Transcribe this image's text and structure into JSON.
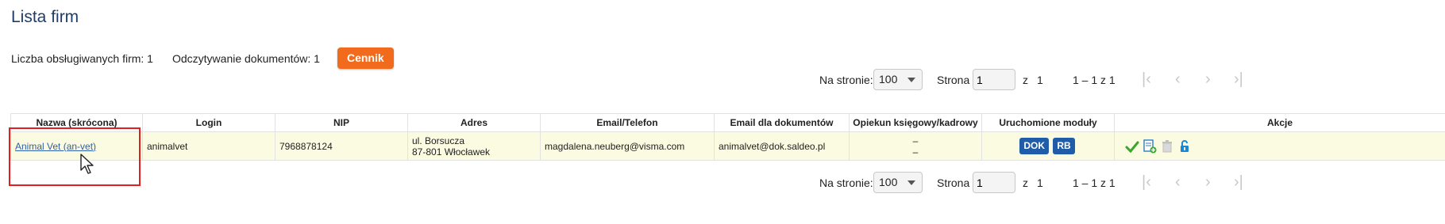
{
  "page": {
    "title": "Lista firm"
  },
  "info": {
    "firms_count": "Liczba obsługiwanych firm: 1",
    "docs_reading": "Odczytywanie dokumentów: 1",
    "pricing_button": "Cennik"
  },
  "pager_top": {
    "per_page_label": "Na stronie:",
    "per_page_value": "100",
    "page_label": "Strona",
    "page_value": "1",
    "of_label": "z",
    "of_total": "1",
    "range": "1 – 1 z 1"
  },
  "pager_bottom": {
    "per_page_label": "Na stronie:",
    "per_page_value": "100",
    "page_label": "Strona",
    "page_value": "1",
    "of_label": "z",
    "of_total": "1",
    "range": "1 – 1 z 1"
  },
  "table": {
    "headers": [
      "Nazwa (skrócona)",
      "Login",
      "NIP",
      "Adres",
      "Email/Telefon",
      "Email dla dokumentów",
      "Opiekun księgowy/kadrowy",
      "Uruchomione moduły",
      "Akcje"
    ],
    "rows": [
      {
        "name": "Animal Vet (an-vet)",
        "login": "animalvet",
        "nip": "7968878124",
        "address_line1": "ul. Borsucza",
        "address_line2": "87-801 Włocławek",
        "email": "magdalena.neuberg@visma.com",
        "doc_email": "animalvet@dok.saldeo.pl",
        "caretaker_line1": "–",
        "caretaker_line2": "–",
        "modules": [
          "DOK",
          "RB"
        ]
      }
    ]
  },
  "colors": {
    "accent": "#f26a1b",
    "title": "#1f3d6b",
    "badge": "#1f5da8",
    "row_bg": "#fbfbe1",
    "highlight": "#e02020"
  },
  "icons": [
    "check-icon",
    "add-document-icon",
    "trash-icon",
    "unlock-icon",
    "first-page-icon",
    "prev-page-icon",
    "next-page-icon",
    "last-page-icon",
    "mouse-cursor-icon"
  ]
}
